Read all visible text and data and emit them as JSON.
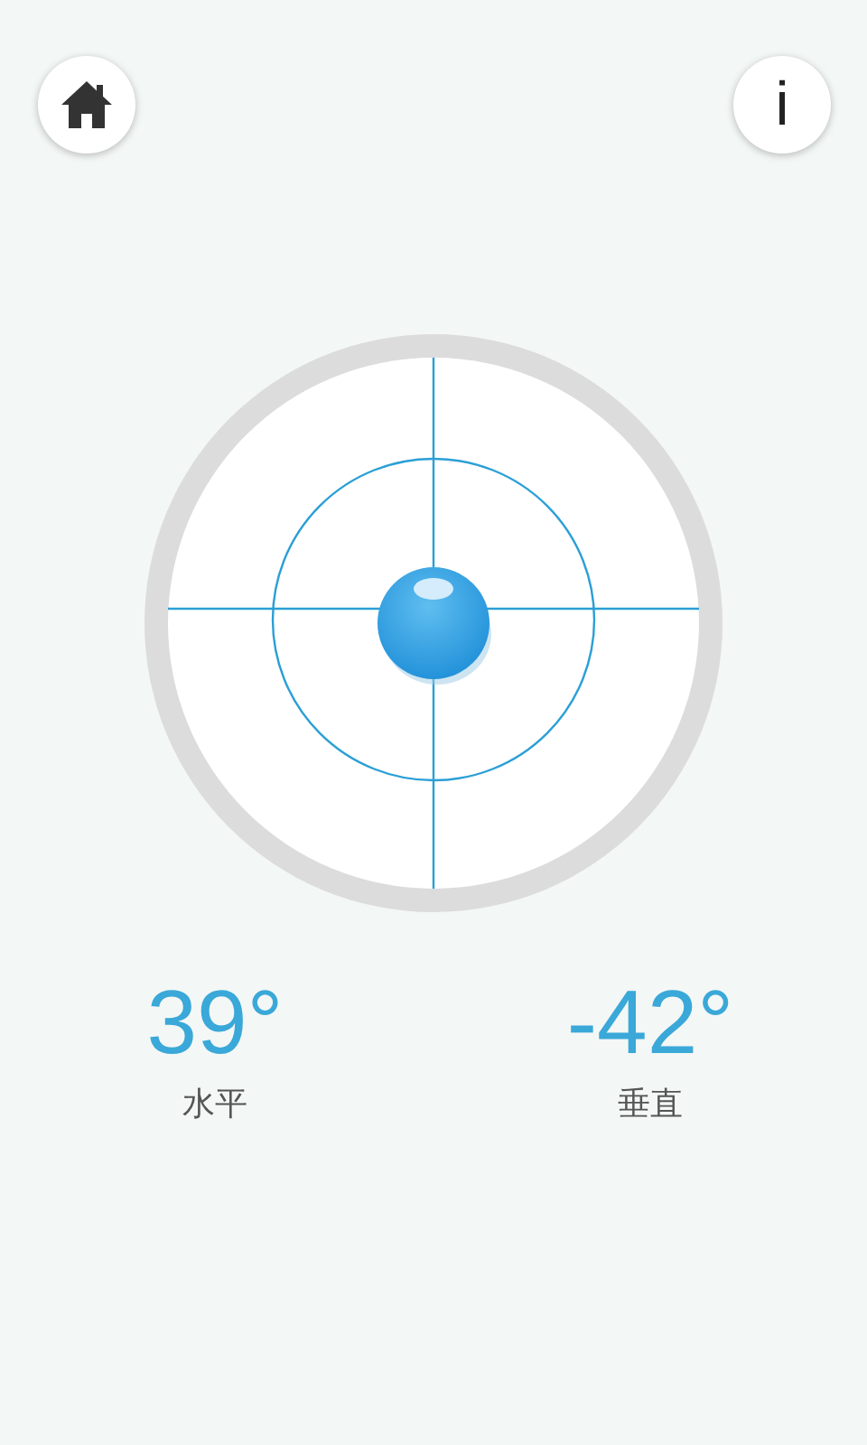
{
  "toolbar": {
    "home_button": {
      "kind": "home"
    },
    "info_button": {
      "label": "i"
    }
  },
  "readings": [
    {
      "value": "39°",
      "label": "水平"
    },
    {
      "value": "-42°",
      "label": "垂直"
    }
  ]
}
